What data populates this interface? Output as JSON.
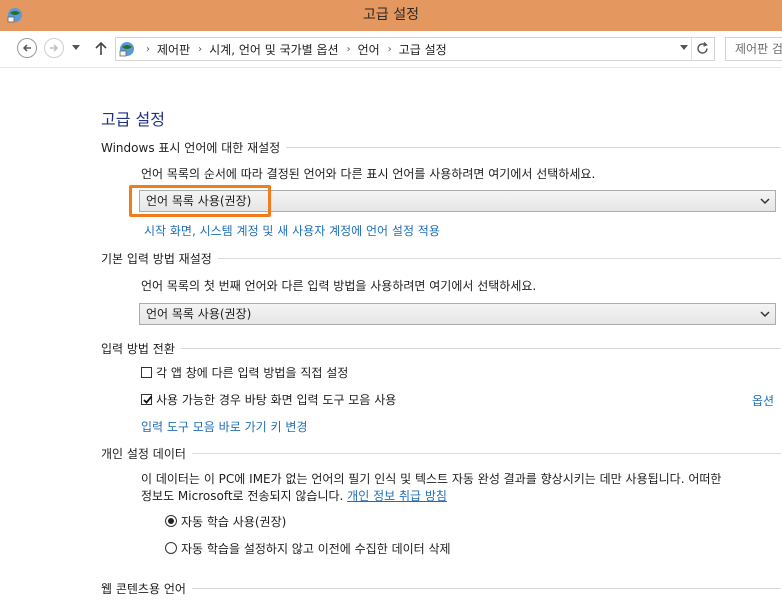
{
  "window": {
    "title": "고급 설정"
  },
  "nav": {
    "breadcrumb": [
      "제어판",
      "시계, 언어 및 국가별 옵션",
      "언어",
      "고급 설정"
    ],
    "search_placeholder": "제어판 검"
  },
  "page": {
    "title": "고급 설정",
    "sections": {
      "display_lang": {
        "heading": "Windows 표시 언어에 대한 재설정",
        "description": "언어 목록의 순서에 따라 결정된 언어와 다른 표시 언어를 사용하려면 여기에서 선택하세요.",
        "selected": "언어 목록 사용(권장)",
        "link": "시작 화면, 시스템 계정 및 새 사용자 계정에 언어 설정 적용"
      },
      "input_method": {
        "heading": "기본 입력 방법 재설정",
        "description": "언어 목록의 첫 번째 언어와 다른 입력 방법을 사용하려면 여기에서 선택하세요.",
        "selected": "언어 목록 사용(권장)"
      },
      "switching": {
        "heading": "입력 방법 전환",
        "checkbox1": {
          "label": "각 앱 창에 다른 입력 방법을 직접 설정",
          "checked": false
        },
        "checkbox2": {
          "label": "사용 가능한 경우 바탕 화면 입력 도구 모음 사용",
          "checked": true
        },
        "options_link": "옵션",
        "hotkey_link": "입력 도구 모음 바로 가기 키 변경"
      },
      "personalization": {
        "heading": "개인 설정 데이터",
        "text_line1": "이 데이터는 이 PC에 IME가 없는 언어의 필기 인식 및 텍스트 자동 완성 결과를 향상시키는 데만 사용됩니다. 어떠한",
        "text_line2": "정보도 Microsoft로 전송되지 않습니다. ",
        "privacy_link": "개인 정보 취급 방침",
        "radio1": {
          "label": "자동 학습 사용(권장)",
          "checked": true
        },
        "radio2": {
          "label": "자동 학습을 설정하지 않고 이전에 수집한 데이터 삭제",
          "checked": false
        }
      },
      "web_content": {
        "heading": "웹 콘텐츠용 언어"
      }
    }
  },
  "colors": {
    "titlebar": "#e4975e",
    "link": "#1f6fb8",
    "heading": "#1e3287",
    "highlight": "#f07c1e"
  }
}
